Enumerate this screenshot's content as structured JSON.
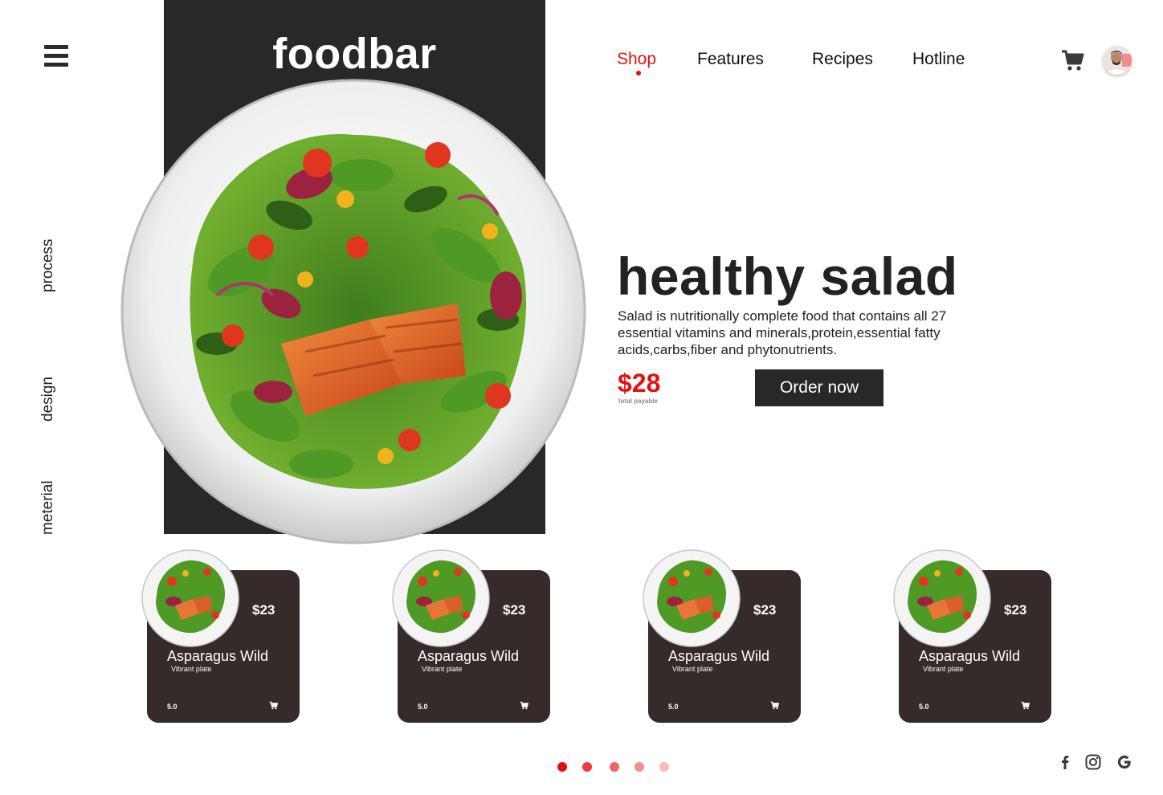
{
  "app": {
    "logo": "foodbar"
  },
  "side_nav": [
    "process",
    "design",
    "meterial"
  ],
  "top_nav": [
    {
      "label": "Shop",
      "active": true
    },
    {
      "label": "Features",
      "active": false
    },
    {
      "label": "Recipes",
      "active": false
    },
    {
      "label": "Hotline",
      "active": false
    }
  ],
  "header_icons": {
    "cart": "cart-icon",
    "avatar": "user-avatar"
  },
  "hero": {
    "title": "healthy salad",
    "description": "Salad is nutritionally complete food that contains all 27 essential vitamins and minerals,protein,essential fatty acids,carbs,fiber and phytonutrients.",
    "price": "$28",
    "price_caption": "total payable",
    "order_label": "Order now"
  },
  "cards": [
    {
      "price": "$23",
      "name": "Asparagus Wild",
      "subtitle": "Vibrant plate",
      "rating": "5.0"
    },
    {
      "price": "$23",
      "name": "Asparagus Wild",
      "subtitle": "Vibrant plate",
      "rating": "5.0"
    },
    {
      "price": "$23",
      "name": "Asparagus Wild",
      "subtitle": "Vibrant plate",
      "rating": "5.0"
    },
    {
      "price": "$23",
      "name": "Asparagus Wild",
      "subtitle": "Vibrant plate",
      "rating": "5.0"
    }
  ],
  "pagination": {
    "total": 5,
    "current": 1
  },
  "social": [
    "facebook-icon",
    "instagram-icon",
    "google-icon"
  ],
  "colors": {
    "accent": "#e4100e",
    "dark": "#282828",
    "card": "#352b2a"
  }
}
